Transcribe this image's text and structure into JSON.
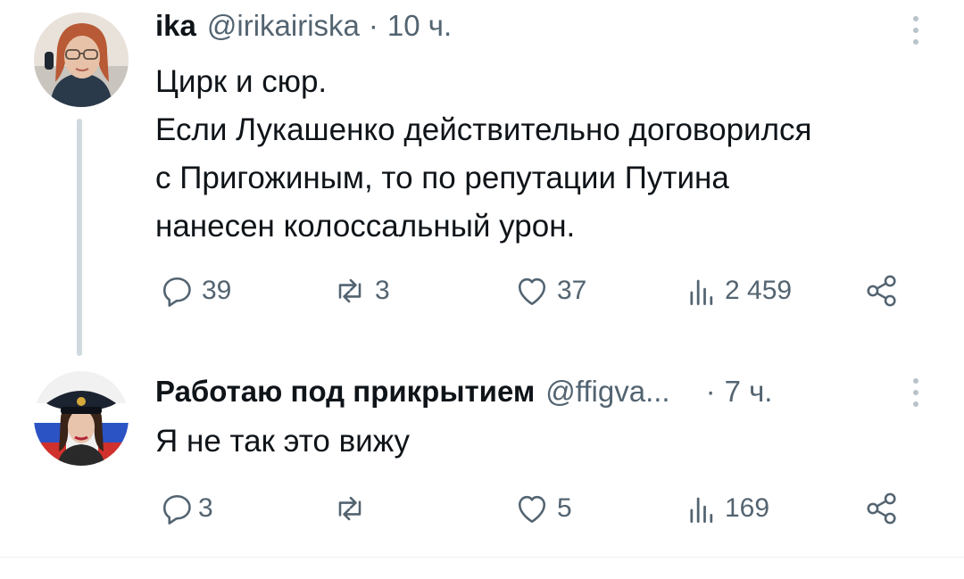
{
  "tweets": [
    {
      "name": "ika",
      "handle": "@irikairiska",
      "separator": "·",
      "time": "10 ч.",
      "lines": [
        "Цирк и сюр.",
        "Если Лукашенко действительно договорился",
        "с Пригожиным, то по репутации Путина",
        "нанесен колоссальный урон."
      ],
      "actions": {
        "replies": "39",
        "retweets": "3",
        "likes": "37",
        "views": "2 459"
      }
    },
    {
      "name": "Работаю под прикрытием",
      "handle": "@ffigva...",
      "separator": "·",
      "time": "7 ч.",
      "lines": [
        "Я не так это вижу"
      ],
      "actions": {
        "replies": "3",
        "retweets": "",
        "likes": "5",
        "views": "169"
      }
    }
  ],
  "icons": {
    "reply": "speech-bubble-icon",
    "retweet": "retweet-arrows-icon",
    "like": "heart-icon",
    "views": "bar-chart-icon",
    "share": "share-nodes-icon",
    "more": "vertical-dots-icon"
  },
  "colors": {
    "text": "#0f1419",
    "secondary": "#536471",
    "thread_line": "#cfd9de"
  }
}
